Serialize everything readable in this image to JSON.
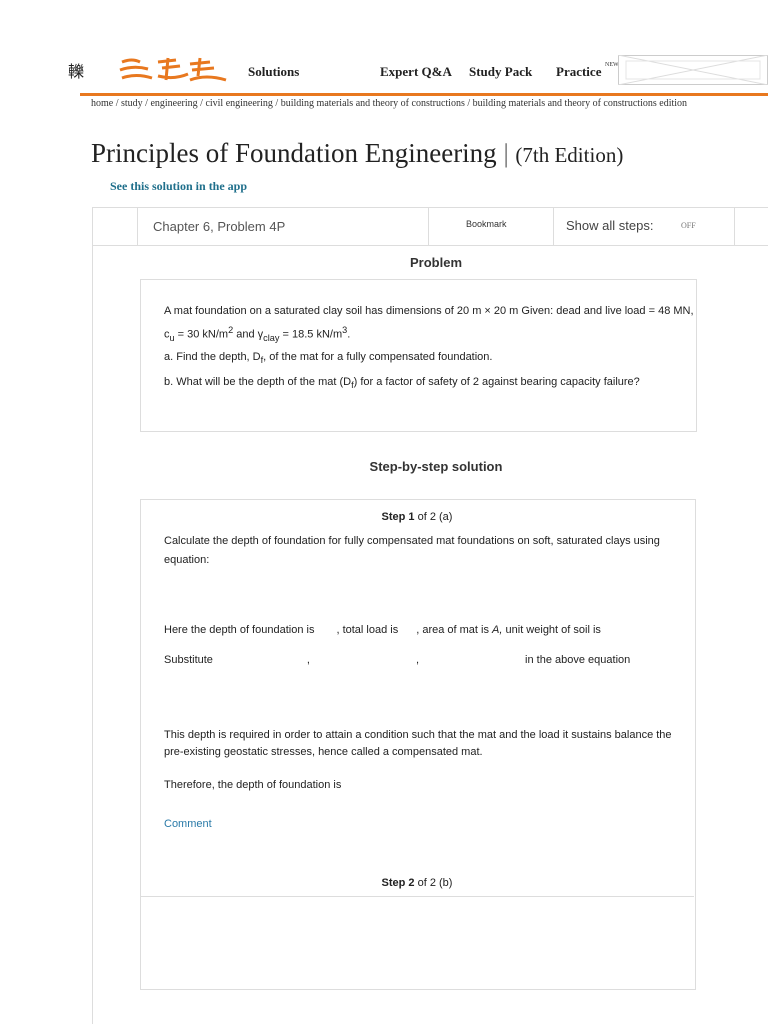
{
  "header": {
    "glyph": "轢",
    "nav": {
      "solutions": "Solutions",
      "expert": "Expert Q&A",
      "study_pack": "Study Pack",
      "practice": "Practice",
      "practice_badge": "NEW"
    },
    "accent_color": "#e8781f"
  },
  "breadcrumb": [
    "home",
    "study",
    "engineering",
    "civil engineering",
    "building materials and theory of constructions",
    "building materials and theory of constructions edition"
  ],
  "title": {
    "book": "Principles of Foundation Engineering",
    "separator": "|",
    "edition": "(7th Edition)"
  },
  "app_link": "See this solution in the app",
  "chapter_bar": {
    "chapter": "Chapter 6, Problem 4P",
    "bookmark": "Bookmark",
    "show_all_steps": "Show all steps:",
    "toggle": "OFF"
  },
  "problem": {
    "heading": "Problem",
    "p1_a": "A mat foundation on a saturated clay soil has dimensions of 20 m × 20 m Given: dead and live load = 48 MN, c",
    "p1_sub_u": "u",
    "p1_b": " = 30 kN/m",
    "p1_sup1": "2",
    "p1_c": " and γ",
    "p1_sub_clay": "clay",
    "p1_d": " = 18.5 kN/m",
    "p1_sup2": "3",
    "p1_e": ".",
    "p2_a": "a. Find the depth, D",
    "p2_sub": "f",
    "p2_b": ", of the mat for a fully compensated foundation.",
    "p3_a": "b. What will be the depth of the mat (D",
    "p3_sub": "f",
    "p3_b": ") for a factor of safety of 2 against bearing capacity failure?"
  },
  "solution": {
    "heading": "Step-by-step solution",
    "step1": {
      "label": "Step 1",
      "suffix": " of 2 (a)",
      "line1": "Calculate the depth of foundation for fully compensated mat foundations on soft, saturated clays using equation:",
      "line2_a": "Here the depth of foundation is",
      "line2_b": ", total load is",
      "line2_c": ", area of mat is",
      "line2_d": "A,",
      "line2_e": "unit weight of soil is",
      "line3_a": "Substitute",
      "line3_b": ",",
      "line3_c": ",",
      "line3_d": "in the above equation",
      "line4": "This depth is required in order to attain a condition such that the mat and the load it sustains balance the pre-existing geostatic stresses, hence called a compensated mat.",
      "line5": "Therefore, the depth of foundation is",
      "comment": "Comment"
    },
    "step2": {
      "label": "Step 2",
      "suffix": " of 2 (b)"
    }
  }
}
